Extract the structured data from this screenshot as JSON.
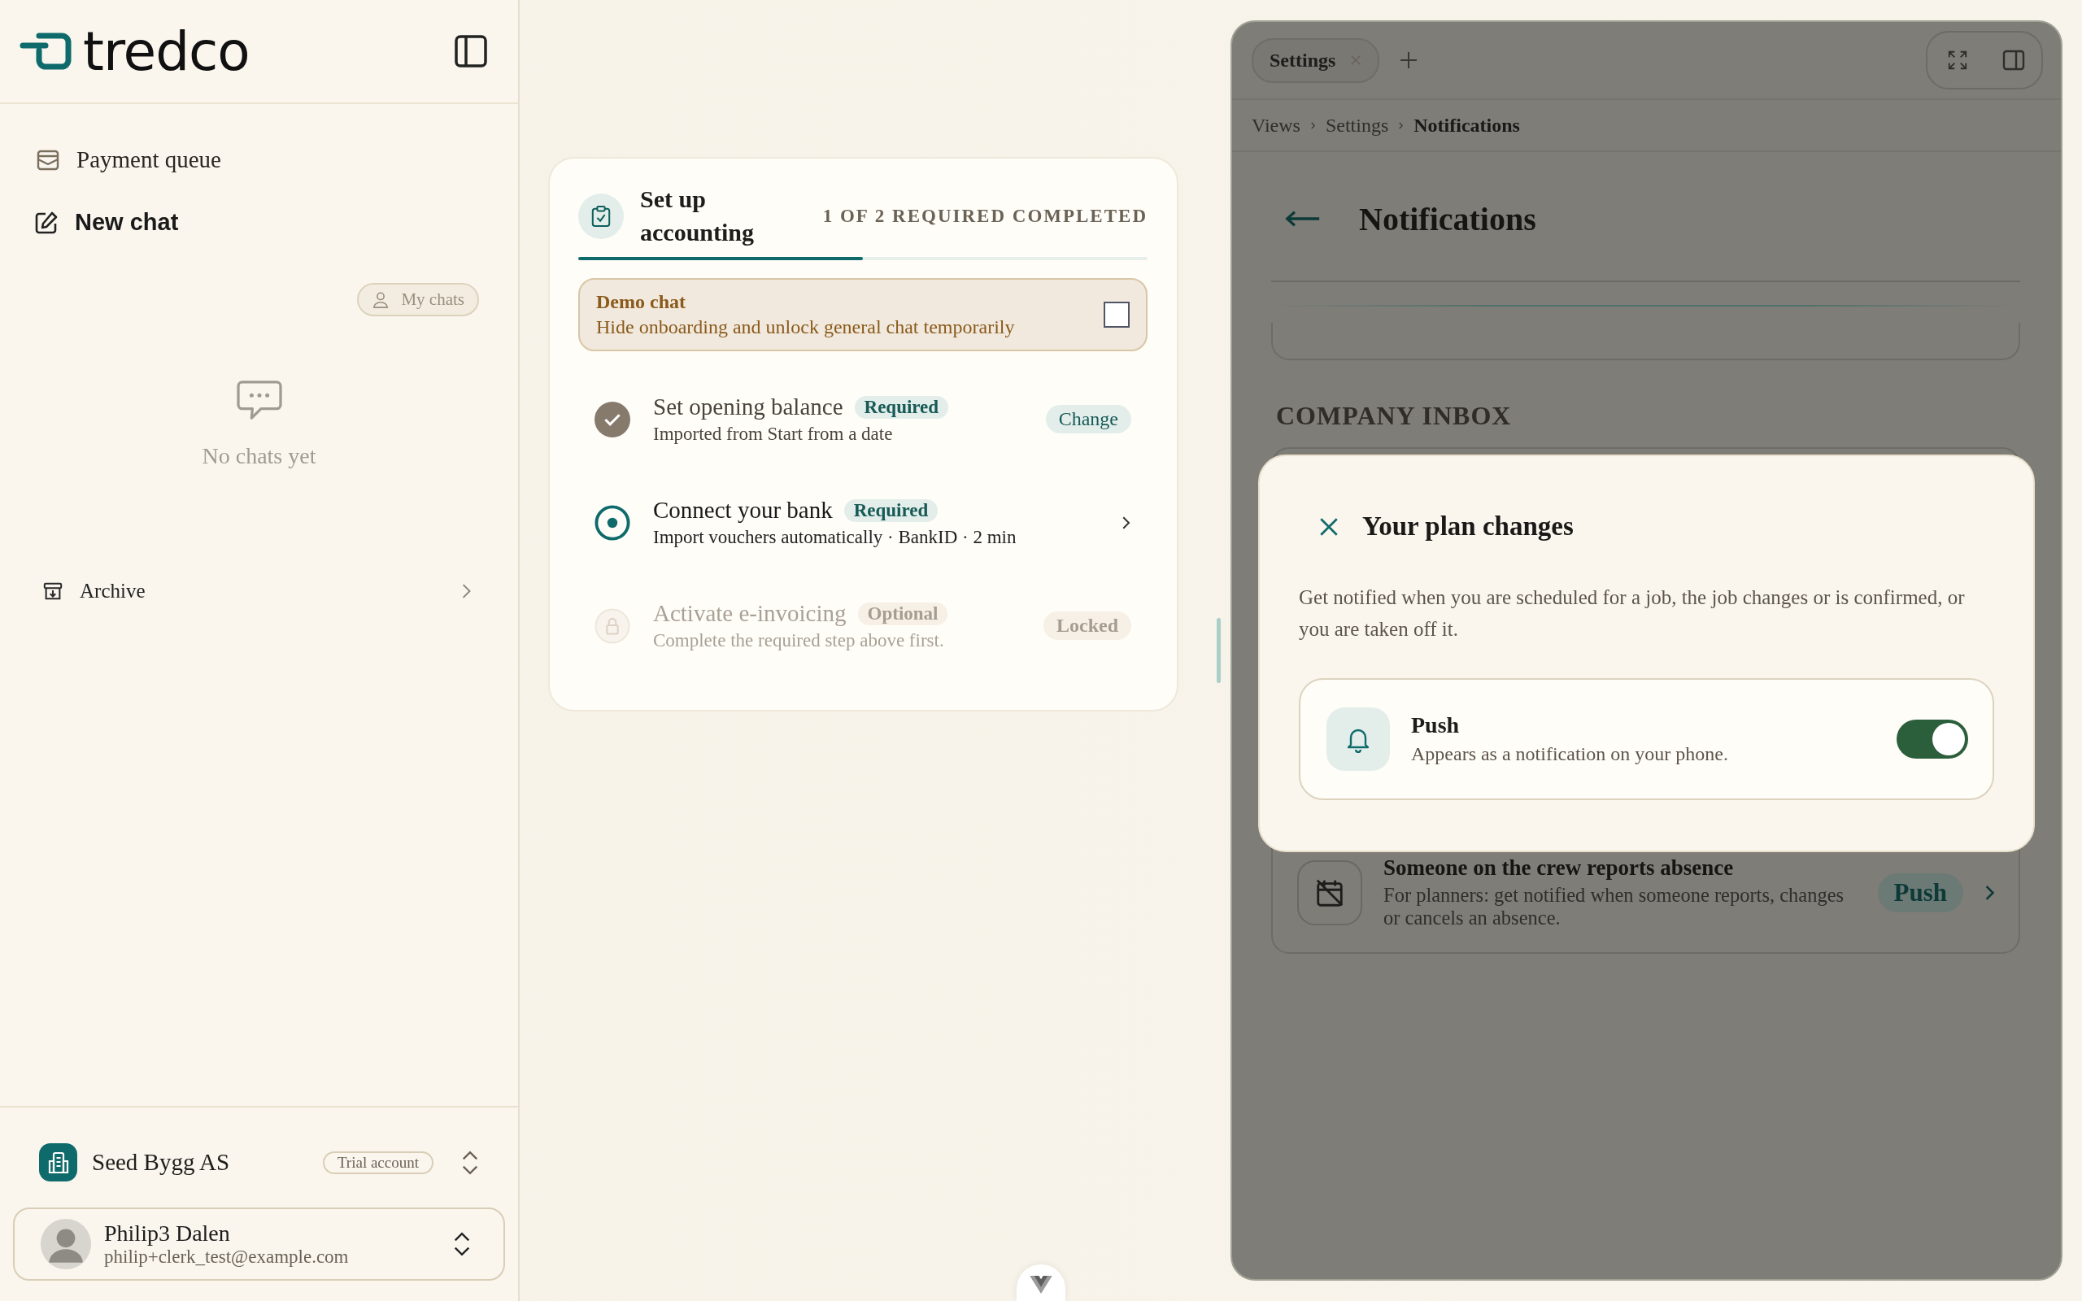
{
  "sidebar": {
    "logo_text": "tredco",
    "nav": [
      {
        "label": "Payment queue",
        "kind": "queue"
      },
      {
        "label": "New chat",
        "kind": "compose"
      }
    ],
    "filter": {
      "label": "My chats"
    },
    "empty_state": "No chats yet",
    "archive": {
      "label": "Archive"
    },
    "company": {
      "name": "Seed Bygg AS",
      "badge": "Trial account"
    },
    "user": {
      "name": "Philip3 Dalen",
      "email": "philip+clerk_test@example.com"
    }
  },
  "onboarding": {
    "title": "Set up accounting",
    "progress_text": "1 OF 2 REQUIRED COMPLETED",
    "level": 0.5,
    "demo": {
      "title": "Demo chat",
      "description": "Hide onboarding and unlock general chat temporarily",
      "checked": false
    },
    "steps": [
      {
        "title": "Set opening balance",
        "tag": "Required",
        "description": "Imported from Start from a date",
        "kind": "done",
        "action": "Change"
      },
      {
        "title": "Connect your bank",
        "tag": "Required",
        "description": "Import vouchers automatically · BankID · 2 min",
        "kind": "current"
      },
      {
        "title": "Activate e-invoicing",
        "tag": "Optional",
        "description": "Complete the required step above first.",
        "kind": "locked",
        "action": "Locked"
      }
    ]
  },
  "drawer": {
    "tabs": [
      {
        "label": "Settings",
        "selected": true
      }
    ],
    "breadcrumb": [
      "Views",
      "Settings",
      "Notifications"
    ],
    "page_title": "Notifications",
    "section_title": "COMPANY INBOX",
    "rows": [
      {
        "title": "Someone on the crew reports absence",
        "description": "For planners: get notified when someone reports, changes or cancels an absence.",
        "channel": "Push"
      }
    ]
  },
  "modal": {
    "title": "Your plan changes",
    "description": "Get notified when you are scheduled for a job, the job changes or is confirmed, or you are taken off it.",
    "options": [
      {
        "title": "Push",
        "description": "Appears as a notification on your phone.",
        "on": true
      }
    ]
  }
}
